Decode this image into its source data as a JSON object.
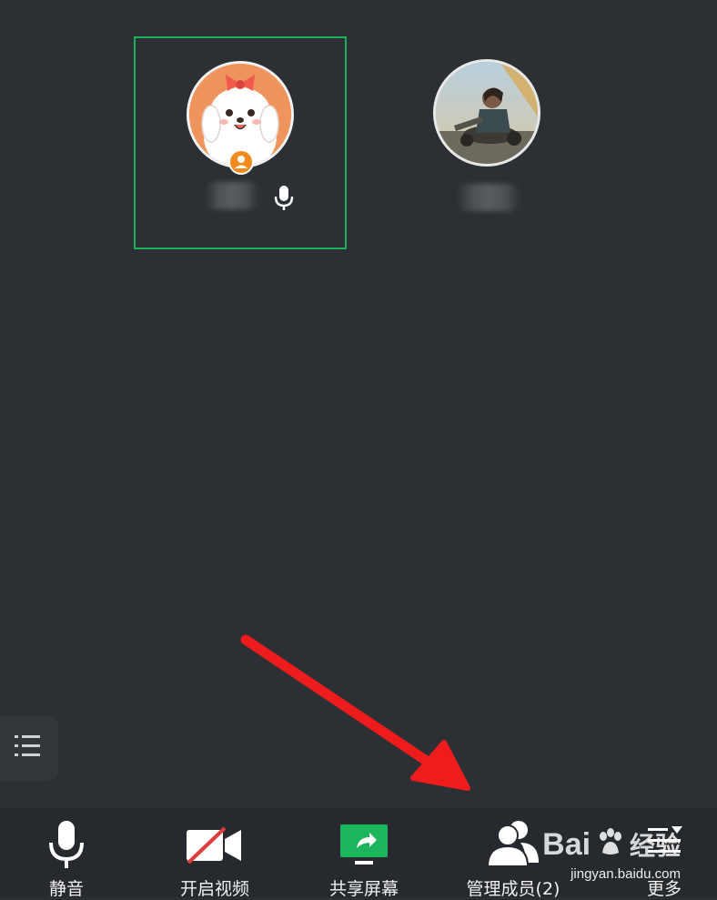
{
  "toolbar": {
    "mute_label": "静音",
    "video_label": "开启视频",
    "share_label": "共享屏幕",
    "members_label": "管理成员(2)",
    "more_label": "更多"
  },
  "watermark": {
    "logo_text": "Bai",
    "logo_text2": "经验",
    "site": "jingyan.baidu.com"
  },
  "colors": {
    "active_border": "#19b35a",
    "host_badge": "#f28a1d",
    "annotation_arrow": "#ee1c1c",
    "share_icon": "#1bb55c"
  },
  "icons": {
    "participant_mic": "microphone-icon",
    "host_badge": "host-user-icon",
    "side_list": "list-icon",
    "mute": "microphone-icon",
    "video": "video-camera-off-icon",
    "share": "share-screen-icon",
    "members": "members-icon",
    "more": "more-icon"
  }
}
